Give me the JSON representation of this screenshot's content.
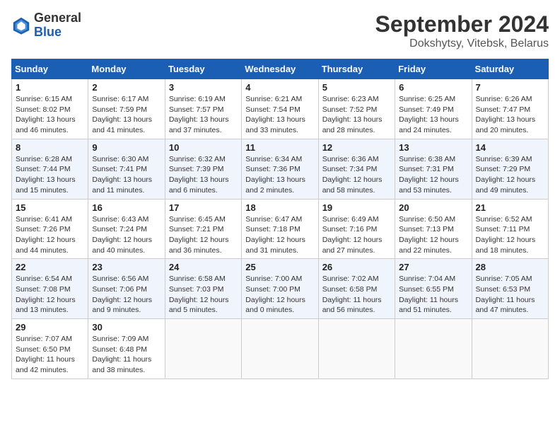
{
  "header": {
    "logo_general": "General",
    "logo_blue": "Blue",
    "title": "September 2024",
    "subtitle": "Dokshytsy, Vitebsk, Belarus"
  },
  "weekdays": [
    "Sunday",
    "Monday",
    "Tuesday",
    "Wednesday",
    "Thursday",
    "Friday",
    "Saturday"
  ],
  "weeks": [
    [
      {
        "day": "1",
        "info": "Sunrise: 6:15 AM\nSunset: 8:02 PM\nDaylight: 13 hours and 46 minutes."
      },
      {
        "day": "2",
        "info": "Sunrise: 6:17 AM\nSunset: 7:59 PM\nDaylight: 13 hours and 41 minutes."
      },
      {
        "day": "3",
        "info": "Sunrise: 6:19 AM\nSunset: 7:57 PM\nDaylight: 13 hours and 37 minutes."
      },
      {
        "day": "4",
        "info": "Sunrise: 6:21 AM\nSunset: 7:54 PM\nDaylight: 13 hours and 33 minutes."
      },
      {
        "day": "5",
        "info": "Sunrise: 6:23 AM\nSunset: 7:52 PM\nDaylight: 13 hours and 28 minutes."
      },
      {
        "day": "6",
        "info": "Sunrise: 6:25 AM\nSunset: 7:49 PM\nDaylight: 13 hours and 24 minutes."
      },
      {
        "day": "7",
        "info": "Sunrise: 6:26 AM\nSunset: 7:47 PM\nDaylight: 13 hours and 20 minutes."
      }
    ],
    [
      {
        "day": "8",
        "info": "Sunrise: 6:28 AM\nSunset: 7:44 PM\nDaylight: 13 hours and 15 minutes."
      },
      {
        "day": "9",
        "info": "Sunrise: 6:30 AM\nSunset: 7:41 PM\nDaylight: 13 hours and 11 minutes."
      },
      {
        "day": "10",
        "info": "Sunrise: 6:32 AM\nSunset: 7:39 PM\nDaylight: 13 hours and 6 minutes."
      },
      {
        "day": "11",
        "info": "Sunrise: 6:34 AM\nSunset: 7:36 PM\nDaylight: 13 hours and 2 minutes."
      },
      {
        "day": "12",
        "info": "Sunrise: 6:36 AM\nSunset: 7:34 PM\nDaylight: 12 hours and 58 minutes."
      },
      {
        "day": "13",
        "info": "Sunrise: 6:38 AM\nSunset: 7:31 PM\nDaylight: 12 hours and 53 minutes."
      },
      {
        "day": "14",
        "info": "Sunrise: 6:39 AM\nSunset: 7:29 PM\nDaylight: 12 hours and 49 minutes."
      }
    ],
    [
      {
        "day": "15",
        "info": "Sunrise: 6:41 AM\nSunset: 7:26 PM\nDaylight: 12 hours and 44 minutes."
      },
      {
        "day": "16",
        "info": "Sunrise: 6:43 AM\nSunset: 7:24 PM\nDaylight: 12 hours and 40 minutes."
      },
      {
        "day": "17",
        "info": "Sunrise: 6:45 AM\nSunset: 7:21 PM\nDaylight: 12 hours and 36 minutes."
      },
      {
        "day": "18",
        "info": "Sunrise: 6:47 AM\nSunset: 7:18 PM\nDaylight: 12 hours and 31 minutes."
      },
      {
        "day": "19",
        "info": "Sunrise: 6:49 AM\nSunset: 7:16 PM\nDaylight: 12 hours and 27 minutes."
      },
      {
        "day": "20",
        "info": "Sunrise: 6:50 AM\nSunset: 7:13 PM\nDaylight: 12 hours and 22 minutes."
      },
      {
        "day": "21",
        "info": "Sunrise: 6:52 AM\nSunset: 7:11 PM\nDaylight: 12 hours and 18 minutes."
      }
    ],
    [
      {
        "day": "22",
        "info": "Sunrise: 6:54 AM\nSunset: 7:08 PM\nDaylight: 12 hours and 13 minutes."
      },
      {
        "day": "23",
        "info": "Sunrise: 6:56 AM\nSunset: 7:06 PM\nDaylight: 12 hours and 9 minutes."
      },
      {
        "day": "24",
        "info": "Sunrise: 6:58 AM\nSunset: 7:03 PM\nDaylight: 12 hours and 5 minutes."
      },
      {
        "day": "25",
        "info": "Sunrise: 7:00 AM\nSunset: 7:00 PM\nDaylight: 12 hours and 0 minutes."
      },
      {
        "day": "26",
        "info": "Sunrise: 7:02 AM\nSunset: 6:58 PM\nDaylight: 11 hours and 56 minutes."
      },
      {
        "day": "27",
        "info": "Sunrise: 7:04 AM\nSunset: 6:55 PM\nDaylight: 11 hours and 51 minutes."
      },
      {
        "day": "28",
        "info": "Sunrise: 7:05 AM\nSunset: 6:53 PM\nDaylight: 11 hours and 47 minutes."
      }
    ],
    [
      {
        "day": "29",
        "info": "Sunrise: 7:07 AM\nSunset: 6:50 PM\nDaylight: 11 hours and 42 minutes."
      },
      {
        "day": "30",
        "info": "Sunrise: 7:09 AM\nSunset: 6:48 PM\nDaylight: 11 hours and 38 minutes."
      },
      {
        "day": "",
        "info": ""
      },
      {
        "day": "",
        "info": ""
      },
      {
        "day": "",
        "info": ""
      },
      {
        "day": "",
        "info": ""
      },
      {
        "day": "",
        "info": ""
      }
    ]
  ]
}
